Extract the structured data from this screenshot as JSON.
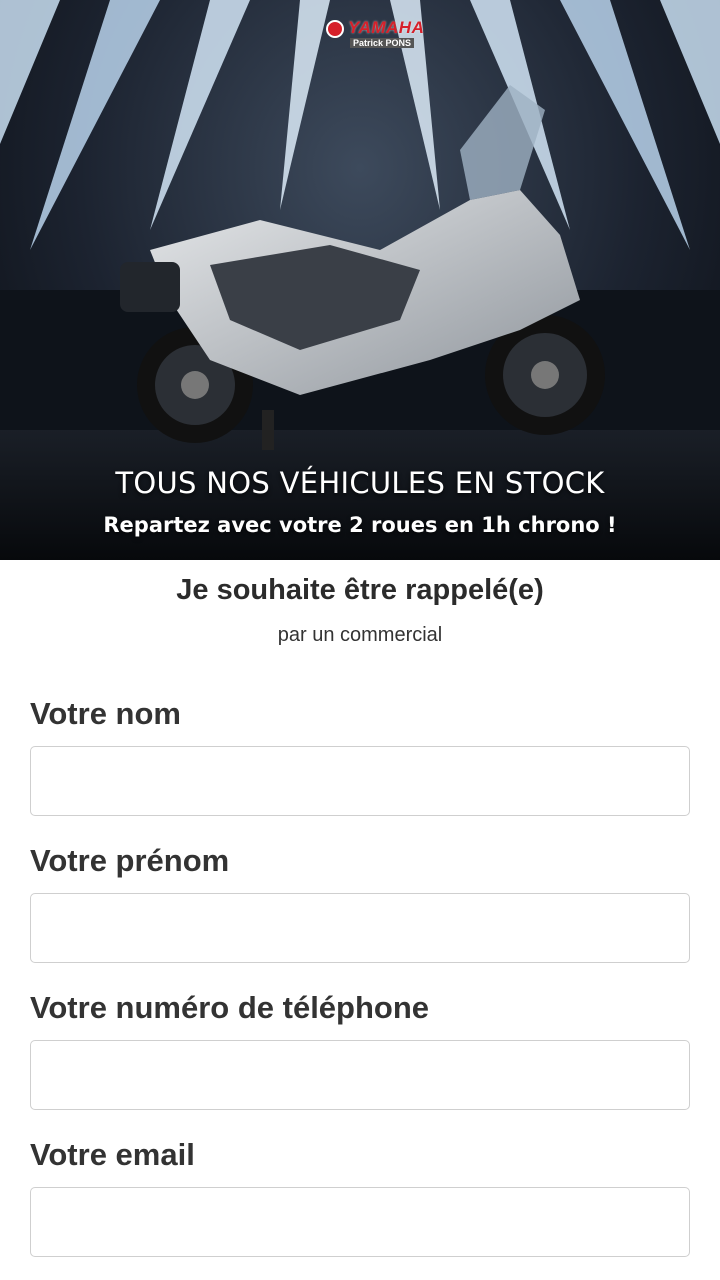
{
  "hero": {
    "logo_word": "YAMAHA",
    "logo_sub": "Patrick PONS",
    "title": "TOUS NOS VÉHICULES EN STOCK",
    "subtitle": "Repartez avec votre 2 roues en 1h chrono !"
  },
  "form": {
    "heading": "Je souhaite être rappelé(e)",
    "subheading": "par un commercial",
    "fields": [
      {
        "label": "Votre nom",
        "value": ""
      },
      {
        "label": "Votre prénom",
        "value": ""
      },
      {
        "label": "Votre numéro de téléphone",
        "value": ""
      },
      {
        "label": "Votre email",
        "value": ""
      }
    ]
  },
  "colors": {
    "brand_red": "#d6202a",
    "text": "#2b2b2b",
    "input_border": "#cfcfcf"
  }
}
